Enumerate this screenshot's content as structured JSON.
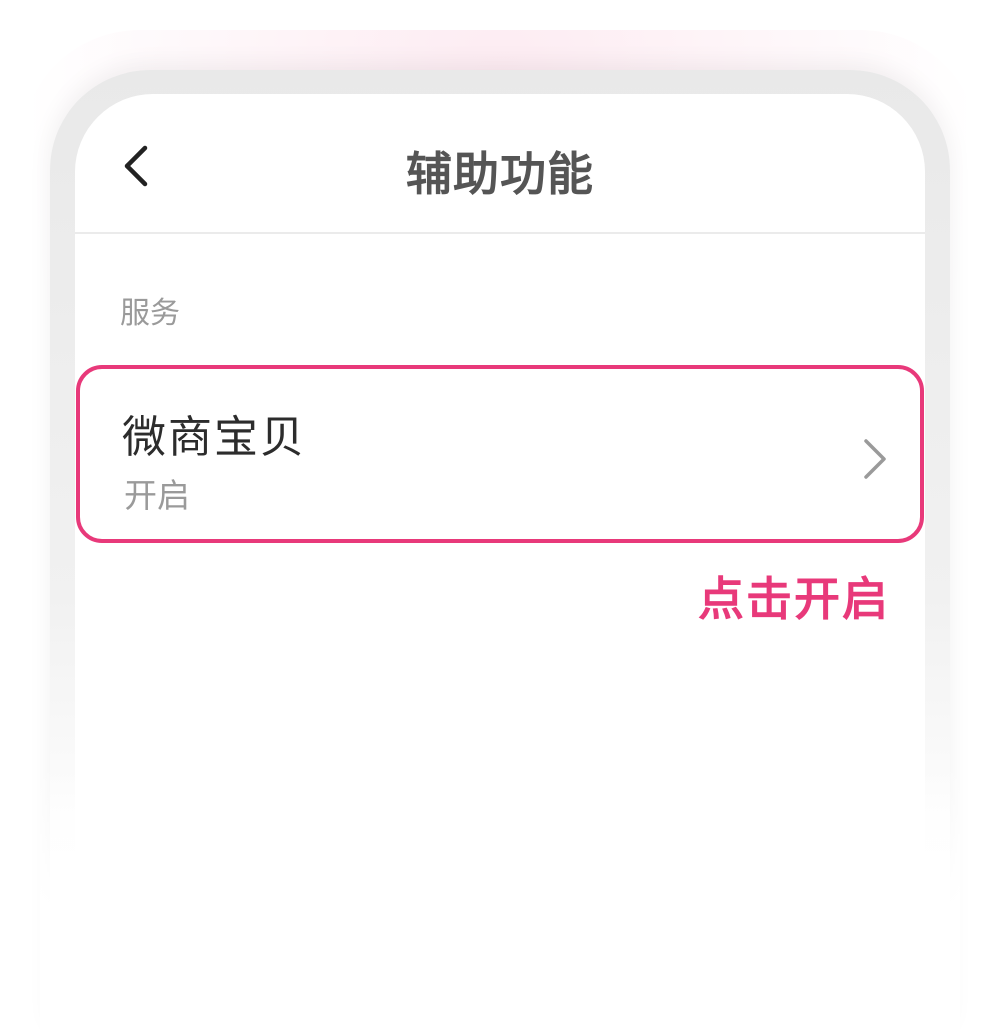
{
  "header": {
    "title": "辅助功能",
    "back_icon": "chevron-left-icon"
  },
  "section": {
    "label": "服务"
  },
  "service_item": {
    "name": "微商宝贝",
    "status": "开启",
    "chevron_icon": "chevron-right-icon",
    "highlight_color": "#e8397a"
  },
  "hint": {
    "text": "点击开启",
    "color": "#e8397a"
  }
}
